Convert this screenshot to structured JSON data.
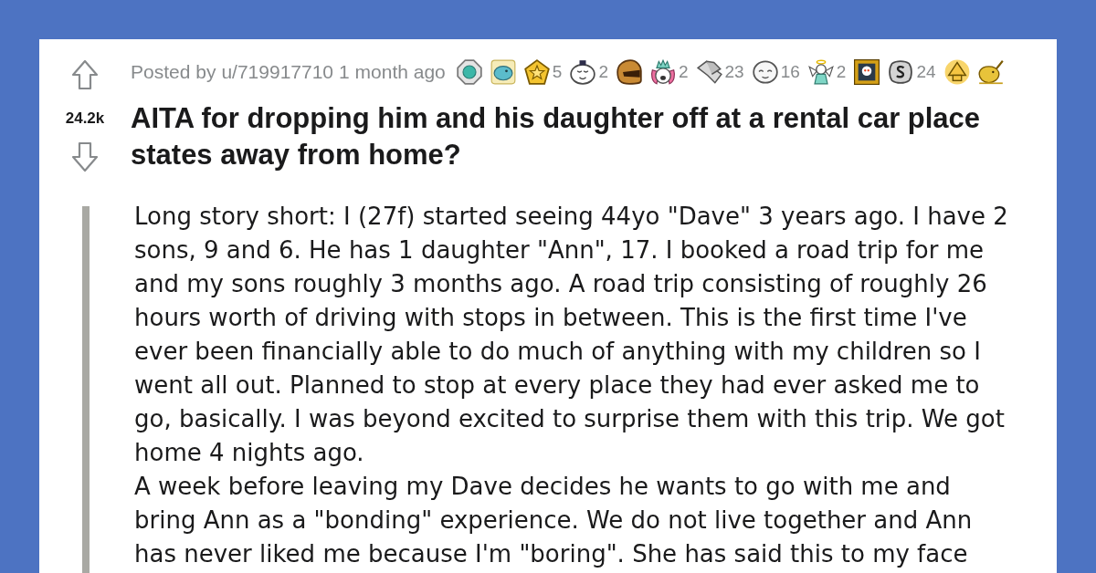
{
  "post": {
    "score": "24.2k",
    "byline": "Posted by",
    "author": "u/719917710",
    "time": "1 month ago",
    "awards": [
      {
        "kind": "gem"
      },
      {
        "kind": "blob"
      },
      {
        "kind": "star",
        "count": "5"
      },
      {
        "kind": "hat-face",
        "count": "2"
      },
      {
        "kind": "chomp"
      },
      {
        "kind": "crown-face",
        "count": "2"
      },
      {
        "kind": "handshake",
        "count": "23"
      },
      {
        "kind": "round-face",
        "count": "16"
      },
      {
        "kind": "angel",
        "count": "2"
      },
      {
        "kind": "portrait"
      },
      {
        "kind": "coin",
        "count": "24"
      },
      {
        "kind": "pyramid"
      },
      {
        "kind": "narwhal"
      }
    ],
    "title": "AITA for dropping him and his daughter off at a rental car place states away from home?",
    "body": [
      "Long story short: I (27f) started seeing 44yo \"Dave\" 3 years ago. I have 2 sons, 9 and 6. He has 1 daughter \"Ann\", 17. I booked a road trip for me and my sons roughly 3 months ago. A road trip consisting of roughly 26 hours worth of driving with stops in between. This is the first time I've ever been financially able to do much of anything with my children so I went all out. Planned to stop at every place they had ever asked me to go, basically. I was beyond excited to surprise them with this trip. We got home 4 nights ago.",
      "A week before leaving my Dave decides he wants to go with me and bring Ann as a \"bonding\" experience. We do not live together and Ann has never liked me because I'm \"boring\". She has said this to my face"
    ]
  }
}
